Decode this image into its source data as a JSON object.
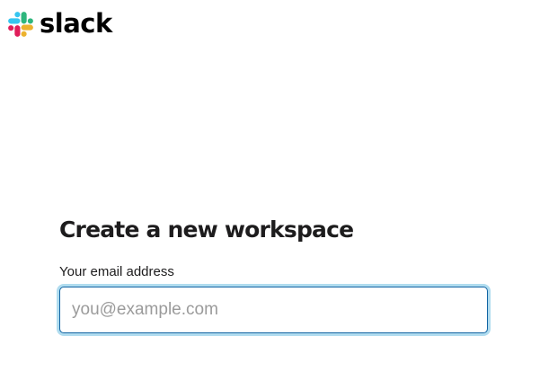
{
  "brand": {
    "name": "slack",
    "colors": {
      "blue": "#36C5F0",
      "green": "#2EB67D",
      "yellow": "#ECB22E",
      "red": "#E01E5A"
    }
  },
  "form": {
    "title": "Create a new workspace",
    "email_label": "Your email address",
    "email_placeholder": "you@example.com",
    "email_value": ""
  }
}
